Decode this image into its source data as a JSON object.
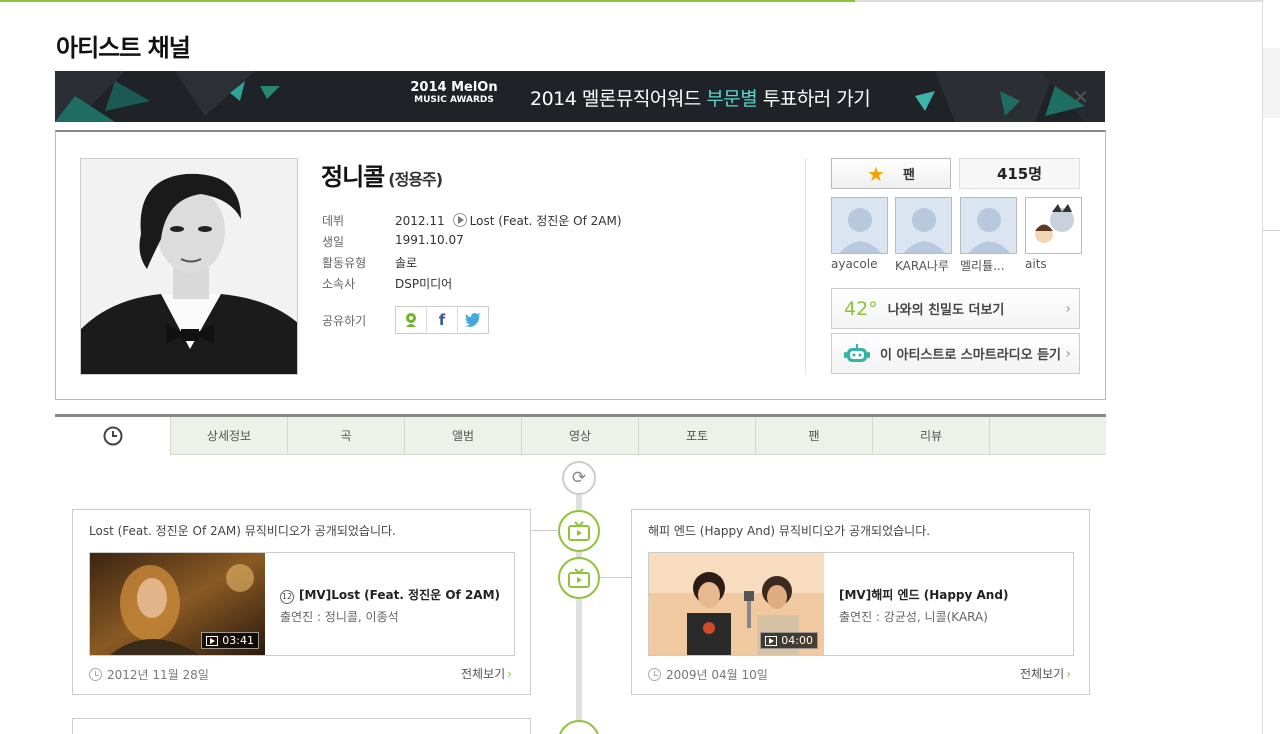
{
  "page": {
    "title": "아티스트 채널"
  },
  "banner": {
    "logo_line1": "2014 MelOn",
    "logo_line2": "MUSIC AWARDS",
    "text_main": "2014 멜론뮤직어워드 ",
    "text_highlight": "부문별",
    "text_tail": " 투표하러 가기",
    "close_icon": "close-icon"
  },
  "artist": {
    "name": "정니콜",
    "real_name": "(정용주)",
    "info": [
      {
        "label": "데뷔",
        "value": "2012.11",
        "extra": "Lost (Feat. 정진운 Of 2AM)"
      },
      {
        "label": "생일",
        "value": "1991.10.07"
      },
      {
        "label": "활동유형",
        "value": "솔로"
      },
      {
        "label": "소속사",
        "value": "DSP미디어"
      }
    ],
    "share_label": "공유하기"
  },
  "fan": {
    "button_label": "팬",
    "count": "415명",
    "fans": [
      "ayacole",
      "KARA나루",
      "멜리튤...",
      "aits"
    ],
    "intimacy_value": "42°",
    "intimacy_label": "나와의 친밀도 더보기",
    "radio_label": "이 아티스트로 스마트라디오 듣기"
  },
  "tabs": [
    "상세정보",
    "곡",
    "앨범",
    "영상",
    "포토",
    "팬",
    "리뷰"
  ],
  "timeline": [
    {
      "title": "Lost (Feat. 정진운 Of 2AM) 뮤직비디오가 공개되었습니다.",
      "age": "12",
      "video_title": "[MV]Lost (Feat. 정진운 Of 2AM)",
      "cast": "출연진 : 정니콜, 이종석",
      "duration": "03:41",
      "date": "2012년 11월 28일",
      "more": "전체보기"
    },
    {
      "title": "해피 엔드 (Happy And) 뮤직비디오가 공개되었습니다.",
      "video_title": "[MV]해피 엔드 (Happy And)",
      "cast": "출연진 : 강균성, 니콜(KARA)",
      "duration": "04:00",
      "date": "2009년 04월 10일",
      "more": "전체보기"
    }
  ],
  "colors": {
    "accent": "#8fc33a",
    "banner_highlight": "#5ad6cf",
    "star": "#f5a300"
  }
}
